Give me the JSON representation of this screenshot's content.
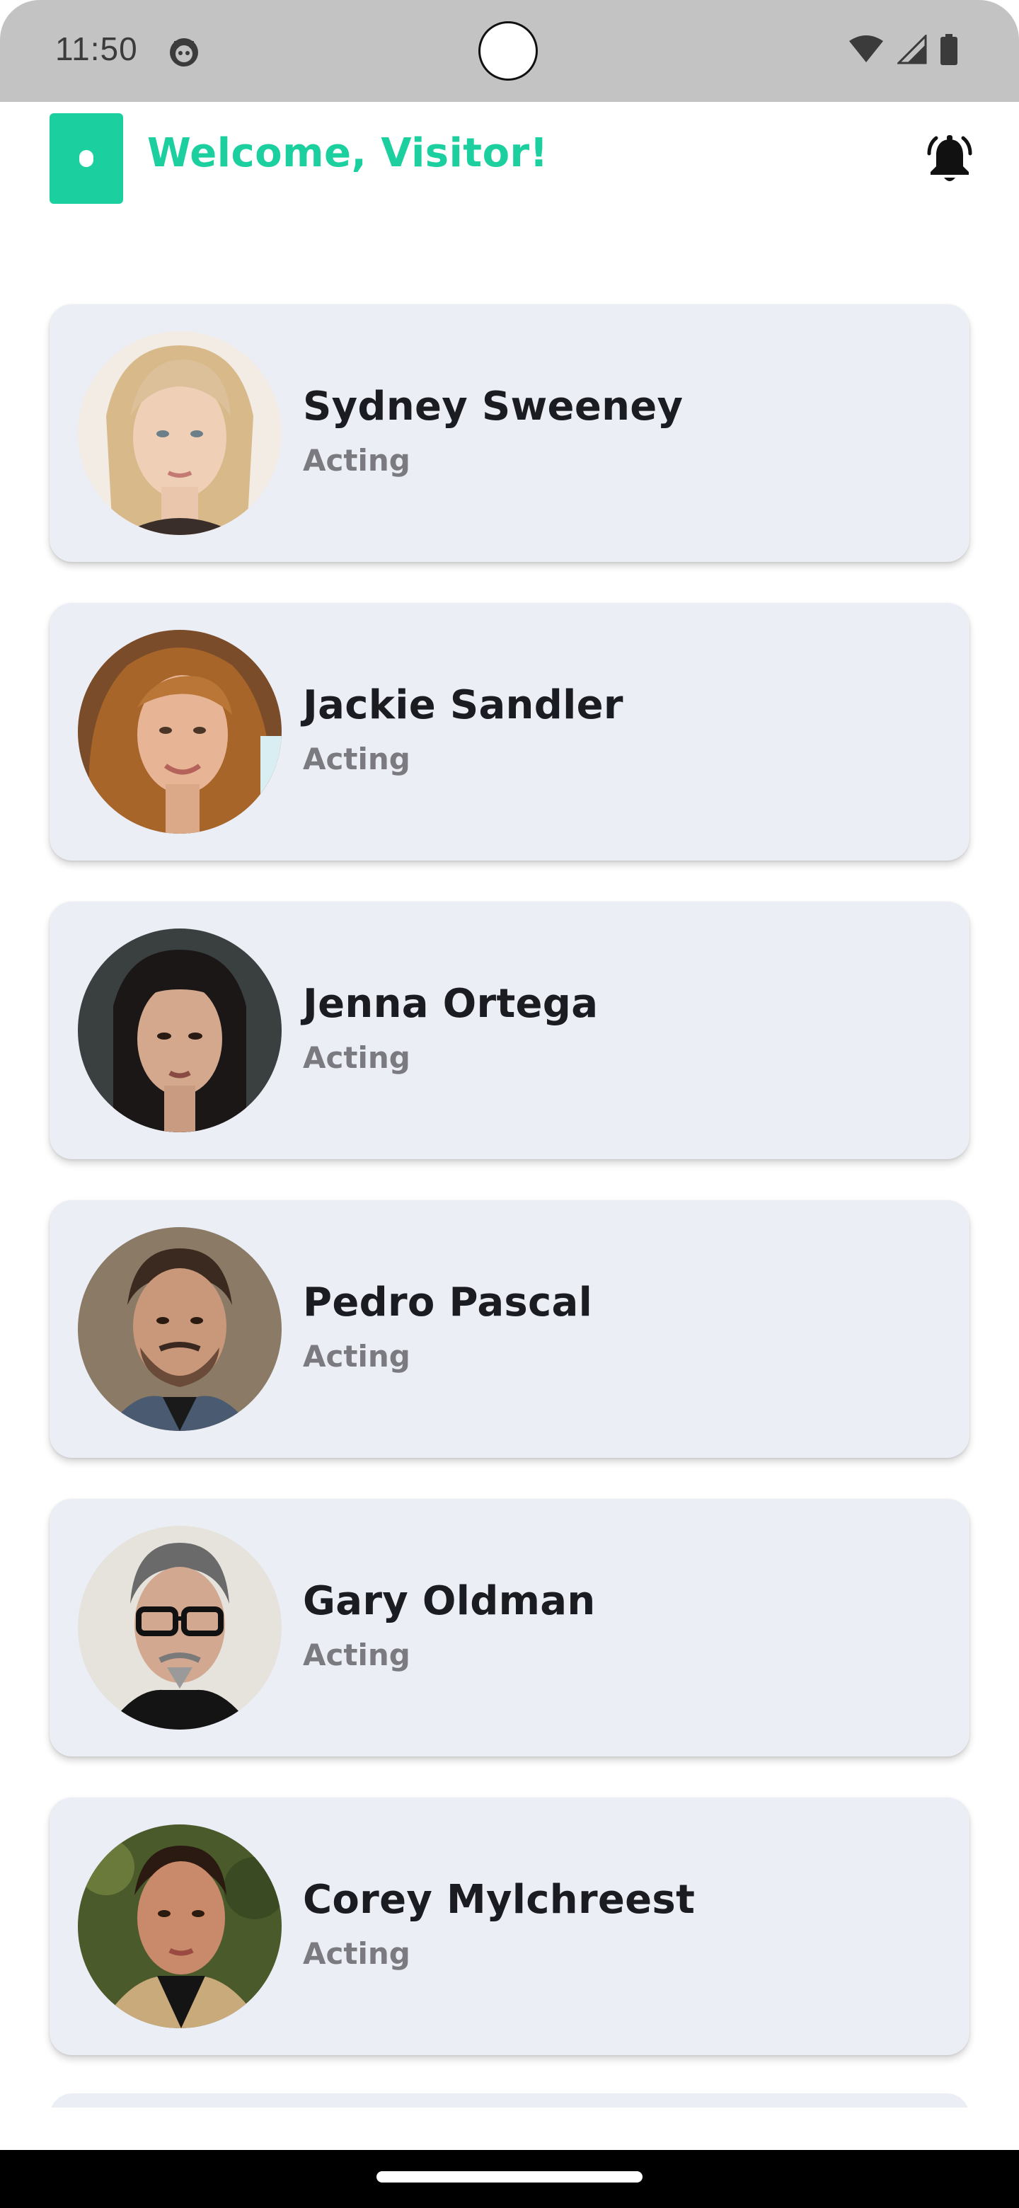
{
  "status_bar": {
    "time": "11:50",
    "icons": [
      "app-notification-icon",
      "wifi-icon",
      "cellular-signal-icon",
      "battery-icon"
    ]
  },
  "header": {
    "title": "Welcome, Visitor!",
    "logo": "app-logo-icon",
    "notification_icon": "bell-icon",
    "accent_color": "#1ccf9f"
  },
  "cards": [
    {
      "name": "Sydney Sweeney",
      "category": "Acting"
    },
    {
      "name": "Jackie Sandler",
      "category": "Acting"
    },
    {
      "name": "Jenna Ortega",
      "category": "Acting"
    },
    {
      "name": "Pedro Pascal",
      "category": "Acting"
    },
    {
      "name": "Gary Oldman",
      "category": "Acting"
    },
    {
      "name": "Corey Mylchreest",
      "category": "Acting"
    }
  ],
  "colors": {
    "card_background": "#eceef5",
    "name_text": "#1b1b22",
    "subtitle_text": "#7a7a80",
    "status_bar": "#c3c3c3",
    "nav_bar": "#000000"
  }
}
